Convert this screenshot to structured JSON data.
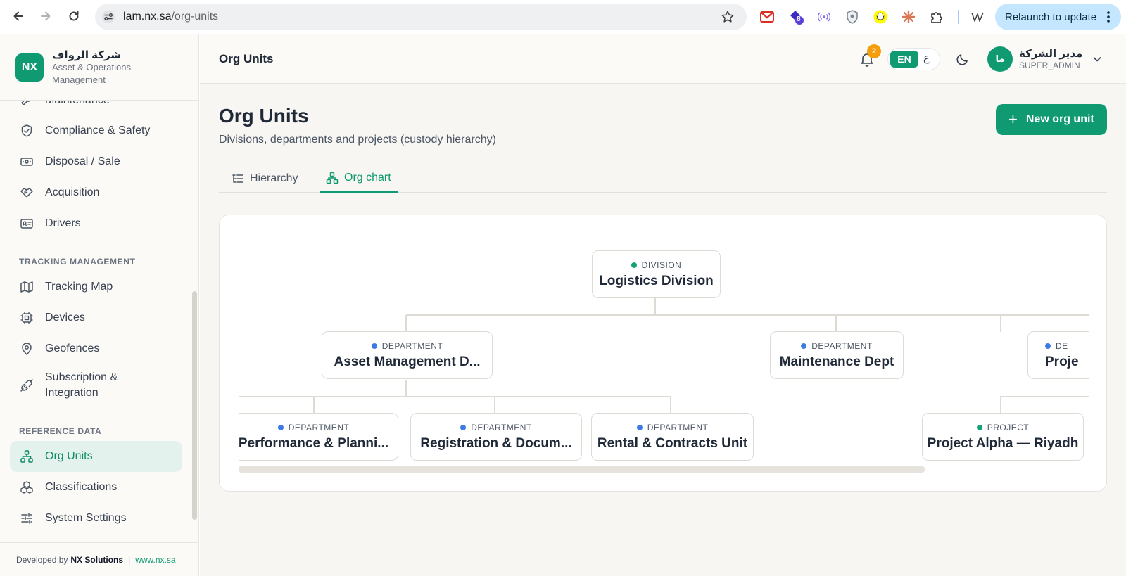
{
  "browser": {
    "url_host": "lam.nx.sa",
    "url_path": "/org-units",
    "ext_badge": "8",
    "relaunch_label": "Relaunch to update"
  },
  "sidebar": {
    "brand": {
      "logo": "NX",
      "name": "شركة الرواف",
      "subtitle": "Asset & Operations Management"
    },
    "items_top": [
      {
        "label": "Maintenance",
        "icon": "wrench-icon"
      },
      {
        "label": "Compliance & Safety",
        "icon": "shield-check-icon"
      },
      {
        "label": "Disposal / Sale",
        "icon": "banknote-icon"
      },
      {
        "label": "Acquisition",
        "icon": "handshake-icon"
      },
      {
        "label": "Drivers",
        "icon": "id-card-icon"
      }
    ],
    "section_tracking": "TRACKING MANAGEMENT",
    "items_tracking": [
      {
        "label": "Tracking Map",
        "icon": "map-icon"
      },
      {
        "label": "Devices",
        "icon": "cpu-icon"
      },
      {
        "label": "Geofences",
        "icon": "map-pin-icon"
      },
      {
        "label": "Subscription & Integration",
        "icon": "plug-icon"
      }
    ],
    "section_reference": "REFERENCE DATA",
    "items_reference": [
      {
        "label": "Org Units",
        "icon": "network-icon",
        "active": true
      },
      {
        "label": "Classifications",
        "icon": "boxes-icon"
      },
      {
        "label": "System Settings",
        "icon": "sliders-icon"
      }
    ],
    "footer": {
      "developed_by": "Developed by",
      "company": "NX Solutions",
      "separator": "|",
      "site": "www.nx.sa"
    }
  },
  "topbar": {
    "title": "Org Units",
    "notifications_count": "2",
    "lang_en": "EN",
    "lang_ar": "ع",
    "avatar_initials": "ما",
    "user_name": "مدير الشركة",
    "user_role": "SUPER_ADMIN"
  },
  "page": {
    "title": "Org Units",
    "subtitle": "Divisions, departments and projects (custody hierarchy)",
    "new_button": "New org unit",
    "tabs": [
      {
        "label": "Hierarchy",
        "icon": "list-tree-icon",
        "active": false
      },
      {
        "label": "Org chart",
        "icon": "network-icon",
        "active": true
      }
    ]
  },
  "org_chart": {
    "colors": {
      "division": "#16a37a",
      "department": "#3b7be6",
      "project": "#16a37a"
    },
    "root": {
      "type": "DIVISION",
      "name": "Logistics Division"
    },
    "level1": [
      {
        "type": "DEPARTMENT",
        "name": "Asset Management D..."
      },
      {
        "type": "DEPARTMENT",
        "name": "Maintenance Dept"
      },
      {
        "type": "DE",
        "name": "Proje"
      }
    ],
    "level2": [
      {
        "type": "DEPARTMENT",
        "name": "Performance & Planni..."
      },
      {
        "type": "DEPARTMENT",
        "name": "Registration & Docum..."
      },
      {
        "type": "DEPARTMENT",
        "name": "Rental & Contracts Unit"
      },
      {
        "type": "PROJECT",
        "name": "Project Alpha — Riyadh"
      }
    ]
  }
}
